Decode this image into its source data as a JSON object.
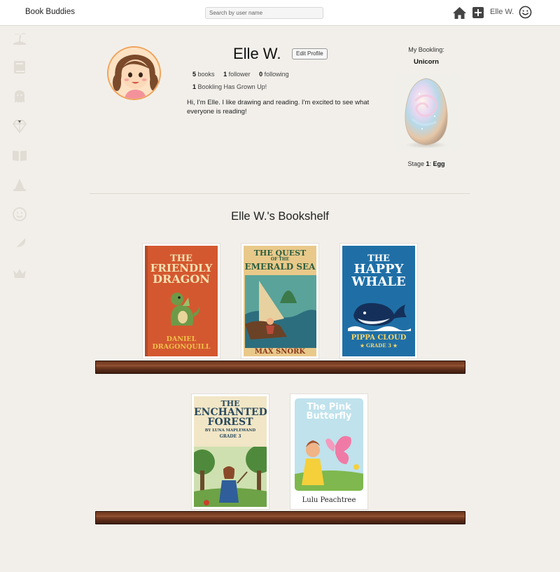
{
  "app": {
    "brand": "Book Buddies"
  },
  "search": {
    "placeholder": "Search by user name"
  },
  "header": {
    "user_name": "Elle W.",
    "icons": [
      "home-icon",
      "plus-icon",
      "smiley-icon"
    ]
  },
  "sidebar": {
    "icons": [
      "island-icon",
      "book-icon",
      "ghost-icon",
      "gem-icon",
      "open-book-icon",
      "wizard-hat-icon",
      "smiley-icon",
      "feather-icon",
      "crown-icon"
    ]
  },
  "profile": {
    "name": "Elle W.",
    "edit_label": "Edit Profile",
    "books_count": "5",
    "books_label": "books",
    "follower_count": "1",
    "follower_label": "follower",
    "following_count": "0",
    "following_label": "following",
    "grown_count": "1",
    "grown_label": "Bookling Has Grown Up!",
    "bio": "Hi, I'm Elle. I like drawing and reading. I'm excited to see what everyone is reading!"
  },
  "bookling": {
    "title": "My Bookling:",
    "name": "Unicorn",
    "stage_label": "Stage",
    "stage_number": "1",
    "stage_name": "Egg"
  },
  "bookshelf": {
    "title": "Elle W.'s Bookshelf",
    "books": [
      {
        "title": "THE FRIENDLY DRAGON",
        "title_lines": [
          "THE",
          "FRIENDLY",
          "DRAGON"
        ],
        "author_lines": [
          "DANIEL",
          "DRAGONQUILL"
        ],
        "bg": "#d4582f",
        "text_color": "#f6e2b3"
      },
      {
        "title": "THE QUEST OF THE EMERALD SEA",
        "title_lines": [
          "THE QUEST",
          "OF THE",
          "EMERALD SEA"
        ],
        "author_lines": [
          "MAX SNORK"
        ],
        "bg": "#2a6b63",
        "text_color": "#f1c24a"
      },
      {
        "title": "THE HAPPY WHALE",
        "title_lines": [
          "THE",
          "HAPPY",
          "WHALE"
        ],
        "author_lines": [
          "PIPPA CLOUD",
          "★ GRADE 3 ★"
        ],
        "bg": "#1f6fa6",
        "text_color": "#ffffff"
      },
      {
        "title": "THE ENCHANTED FOREST",
        "title_lines": [
          "THE",
          "ENCHANTED",
          "FOREST"
        ],
        "subtitle_lines": [
          "BY LUNA MAPLEWAND",
          "GRADE 3"
        ],
        "bg": "#f1e6c6",
        "text_color": "#2a4a5e"
      },
      {
        "title": "The Pink Butterfly",
        "title_lines": [
          "The Pink",
          "Butterfly"
        ],
        "author_lines": [
          "Lulu Peachtree"
        ],
        "bg": "#bfe2ec",
        "text_color": "#ffffff"
      }
    ]
  }
}
